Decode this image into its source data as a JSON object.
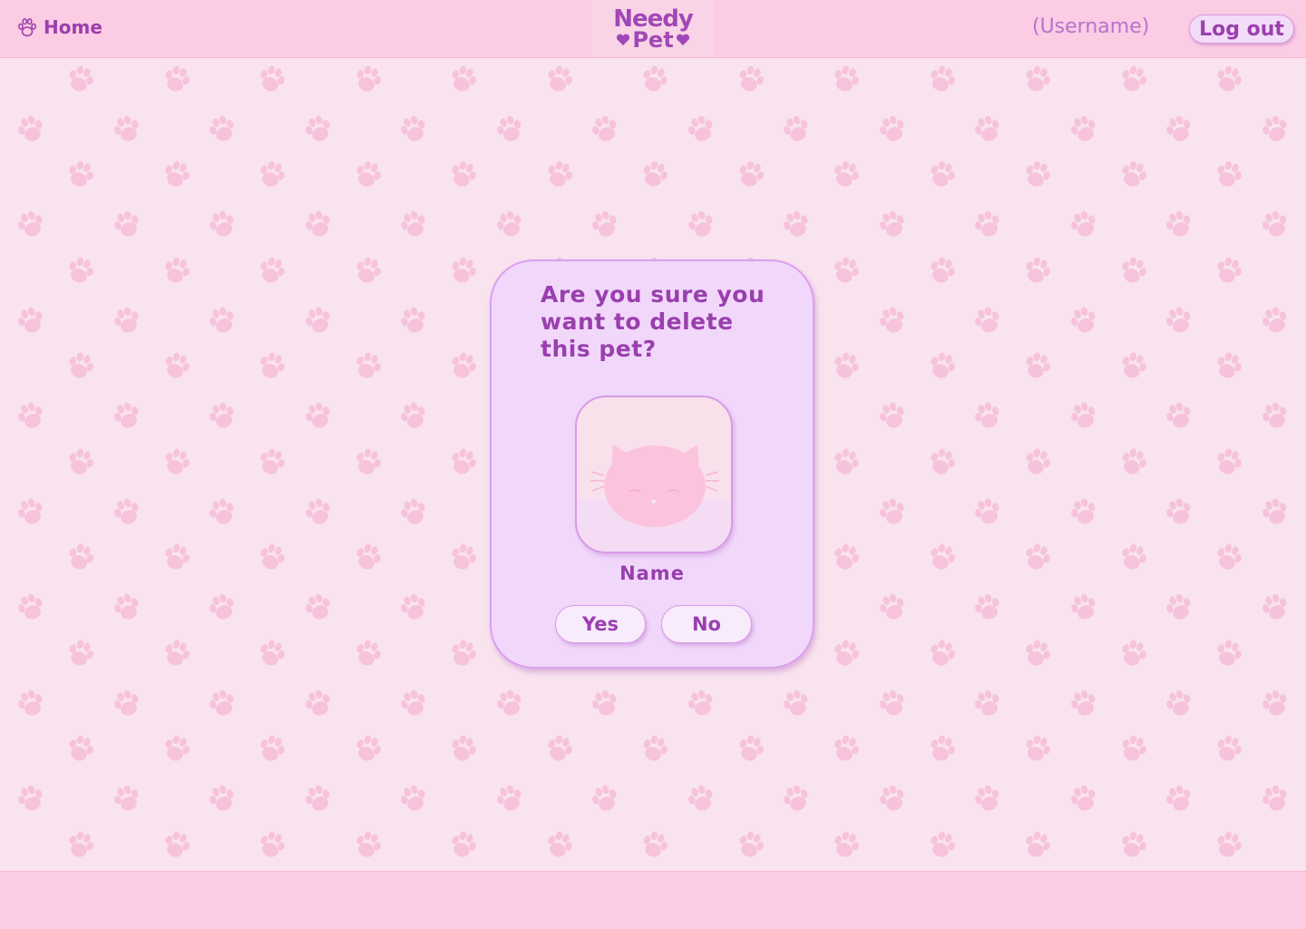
{
  "header": {
    "home_label": "Home",
    "logo_line1": "Needy",
    "logo_line2": "Pet",
    "username": "(Username)",
    "logout_label": "Log out"
  },
  "dialog": {
    "question": "Are you sure you want to delete this pet?",
    "pet_name": "Name",
    "yes_label": "Yes",
    "no_label": "No"
  },
  "icons": {
    "home": "paw-icon",
    "logo_hearts": "heart-icon",
    "pet_avatar": "cat-face-icon",
    "background": "paw-print-pattern"
  },
  "colors": {
    "header_bg": "#fccbe4",
    "page_bg": "#f9e3ee",
    "paw_pattern": "#f7c2dc",
    "accent_text": "#9a3fae",
    "dialog_bg": "#f1d8fb",
    "dialog_border": "#dba0ee",
    "cat": "#fbc3de"
  }
}
